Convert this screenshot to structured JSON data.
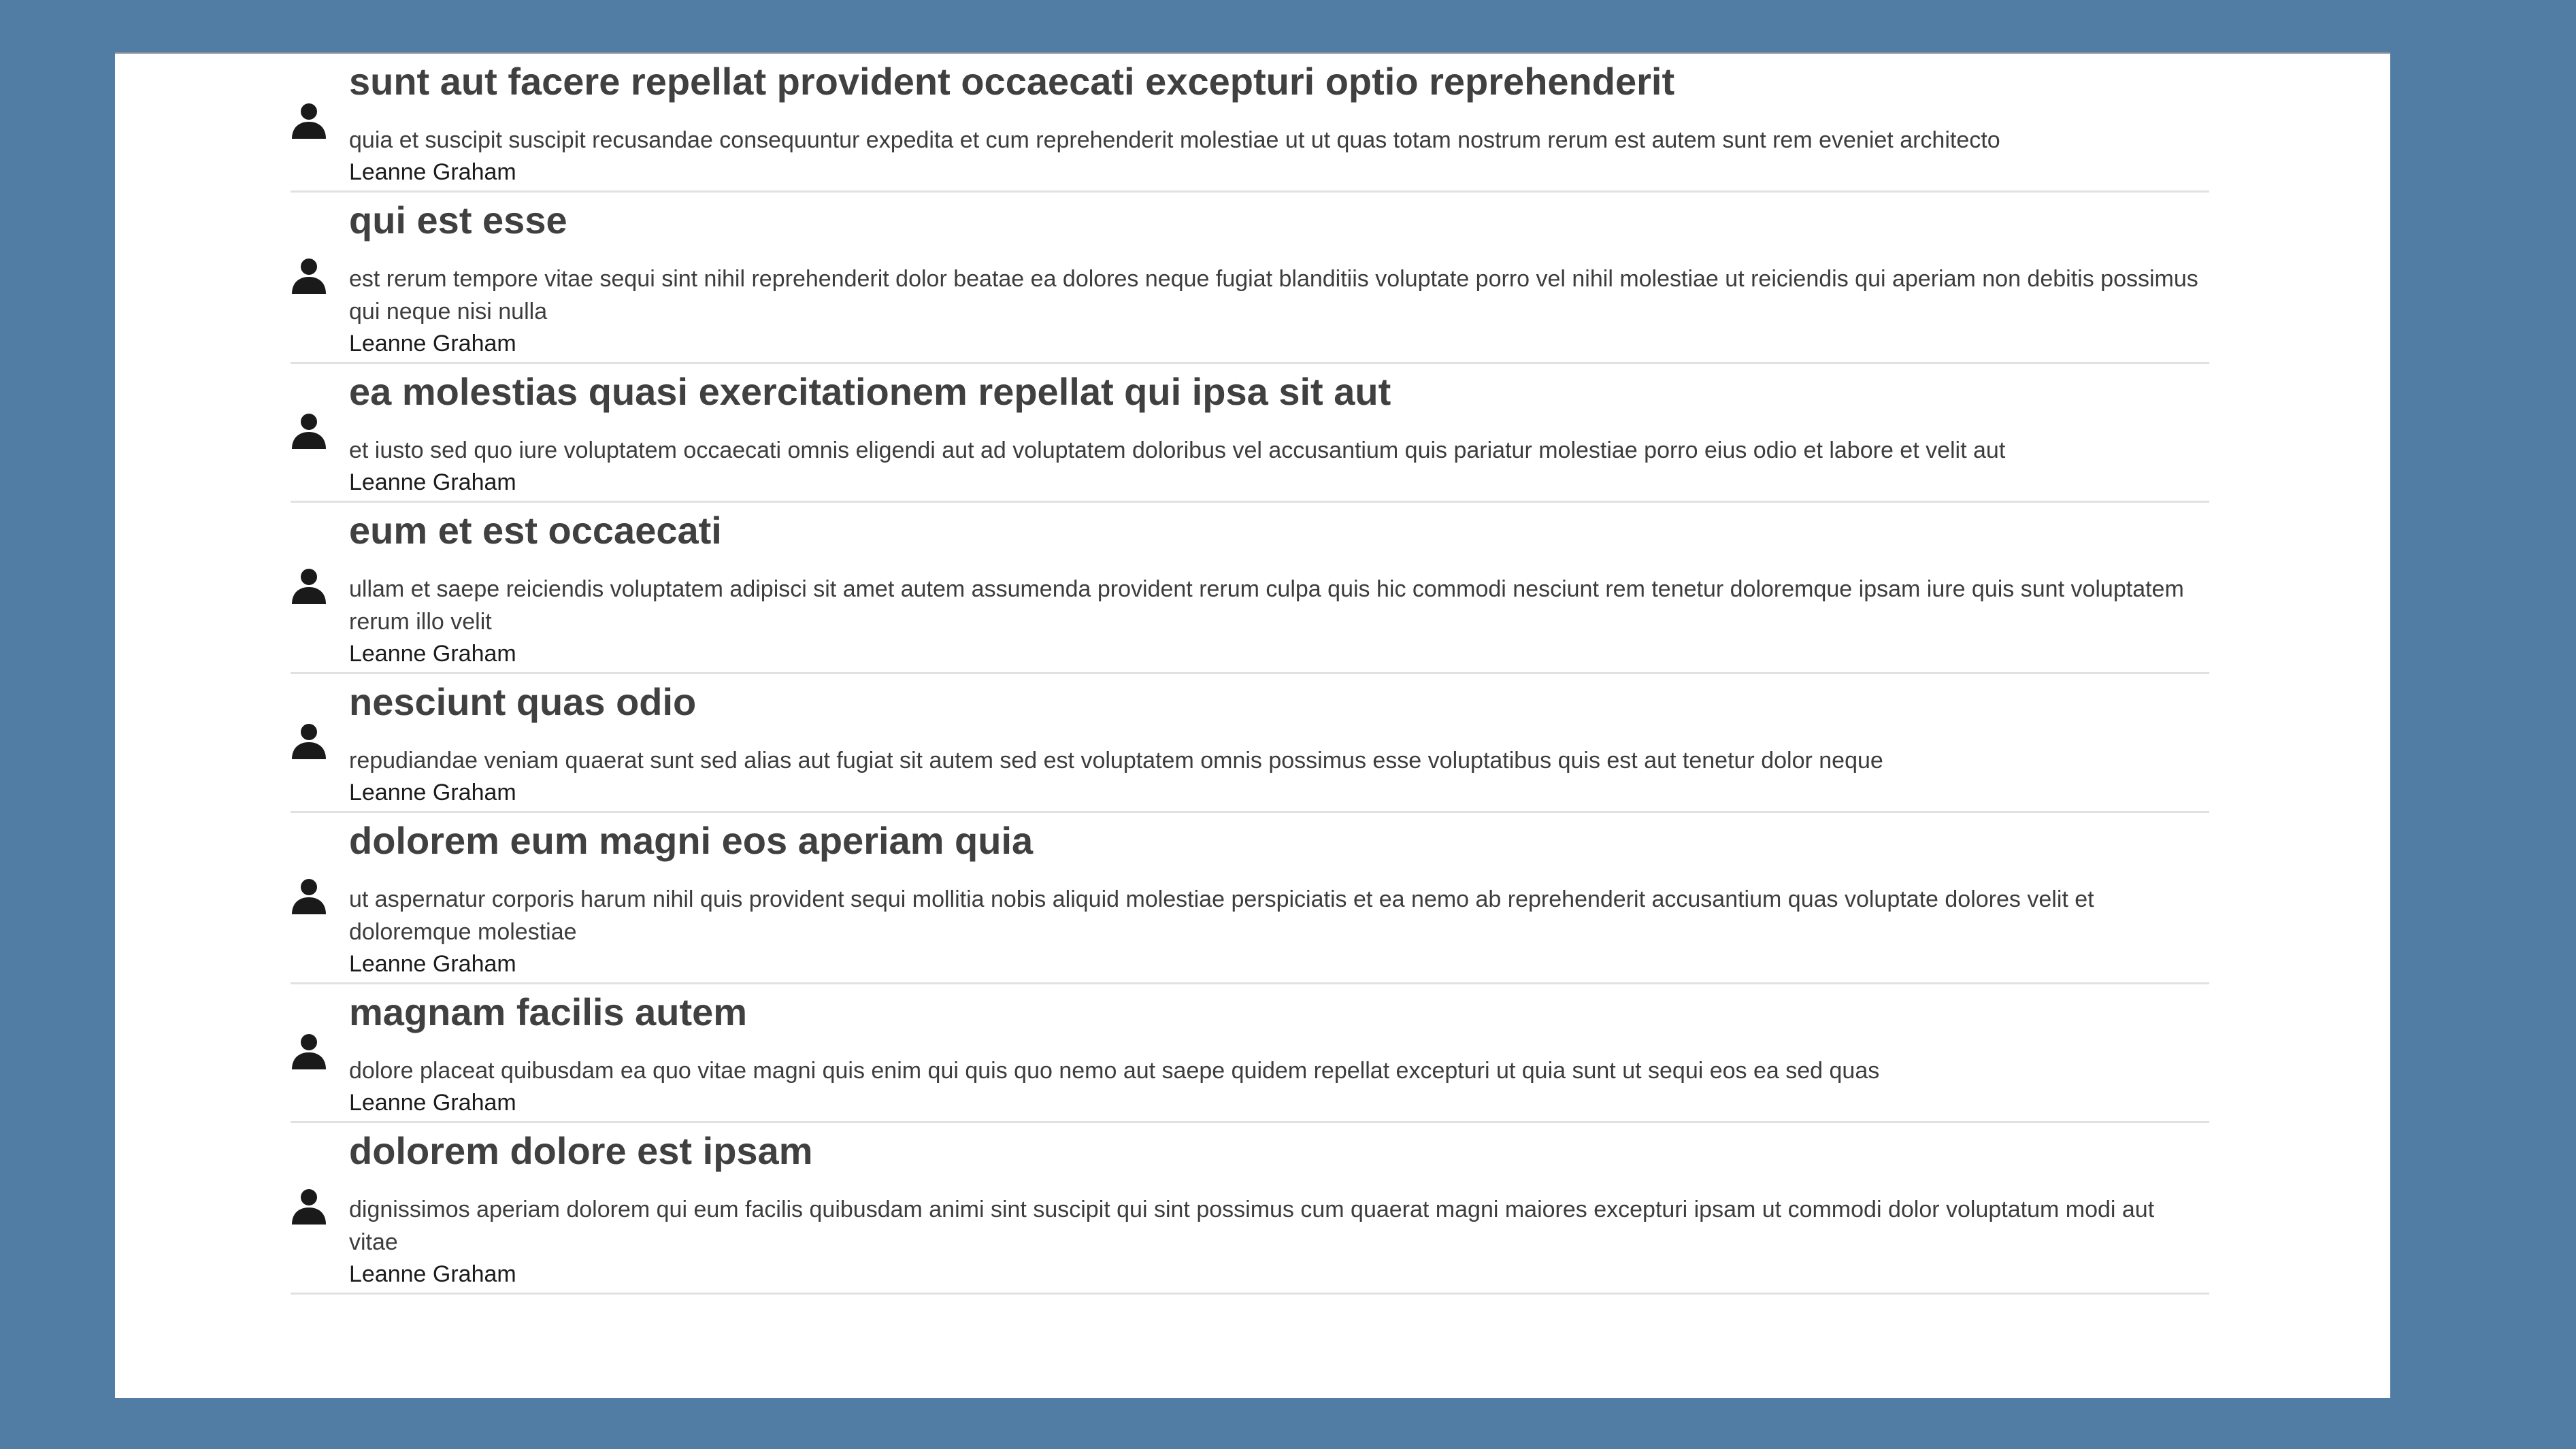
{
  "colors": {
    "background": "#517ca4",
    "panel": "#ffffff",
    "title": "#404040",
    "body": "#3d3d3d",
    "author": "#1b1b1b",
    "divider": "#e1e1e1",
    "icon": "#1a1a1a"
  },
  "icon": "user-icon",
  "posts": [
    {
      "title": "sunt aut facere repellat provident occaecati excepturi optio reprehenderit",
      "body": "quia et suscipit suscipit recusandae consequuntur expedita et cum reprehenderit molestiae ut ut quas totam nostrum rerum est autem sunt rem eveniet architecto",
      "author": "Leanne Graham"
    },
    {
      "title": "qui est esse",
      "body": "est rerum tempore vitae sequi sint nihil reprehenderit dolor beatae ea dolores neque fugiat blanditiis voluptate porro vel nihil molestiae ut reiciendis qui aperiam non debitis possimus qui neque nisi nulla",
      "author": "Leanne Graham"
    },
    {
      "title": "ea molestias quasi exercitationem repellat qui ipsa sit aut",
      "body": "et iusto sed quo iure voluptatem occaecati omnis eligendi aut ad voluptatem doloribus vel accusantium quis pariatur molestiae porro eius odio et labore et velit aut",
      "author": "Leanne Graham"
    },
    {
      "title": "eum et est occaecati",
      "body": "ullam et saepe reiciendis voluptatem adipisci sit amet autem assumenda provident rerum culpa quis hic commodi nesciunt rem tenetur doloremque ipsam iure quis sunt voluptatem rerum illo velit",
      "author": "Leanne Graham"
    },
    {
      "title": "nesciunt quas odio",
      "body": "repudiandae veniam quaerat sunt sed alias aut fugiat sit autem sed est voluptatem omnis possimus esse voluptatibus quis est aut tenetur dolor neque",
      "author": "Leanne Graham"
    },
    {
      "title": "dolorem eum magni eos aperiam quia",
      "body": "ut aspernatur corporis harum nihil quis provident sequi mollitia nobis aliquid molestiae perspiciatis et ea nemo ab reprehenderit accusantium quas voluptate dolores velit et doloremque molestiae",
      "author": "Leanne Graham"
    },
    {
      "title": "magnam facilis autem",
      "body": "dolore placeat quibusdam ea quo vitae magni quis enim qui quis quo nemo aut saepe quidem repellat excepturi ut quia sunt ut sequi eos ea sed quas",
      "author": "Leanne Graham"
    },
    {
      "title": "dolorem dolore est ipsam",
      "body": "dignissimos aperiam dolorem qui eum facilis quibusdam animi sint suscipit qui sint possimus cum quaerat magni maiores excepturi ipsam ut commodi dolor voluptatum modi aut vitae",
      "author": "Leanne Graham"
    }
  ]
}
